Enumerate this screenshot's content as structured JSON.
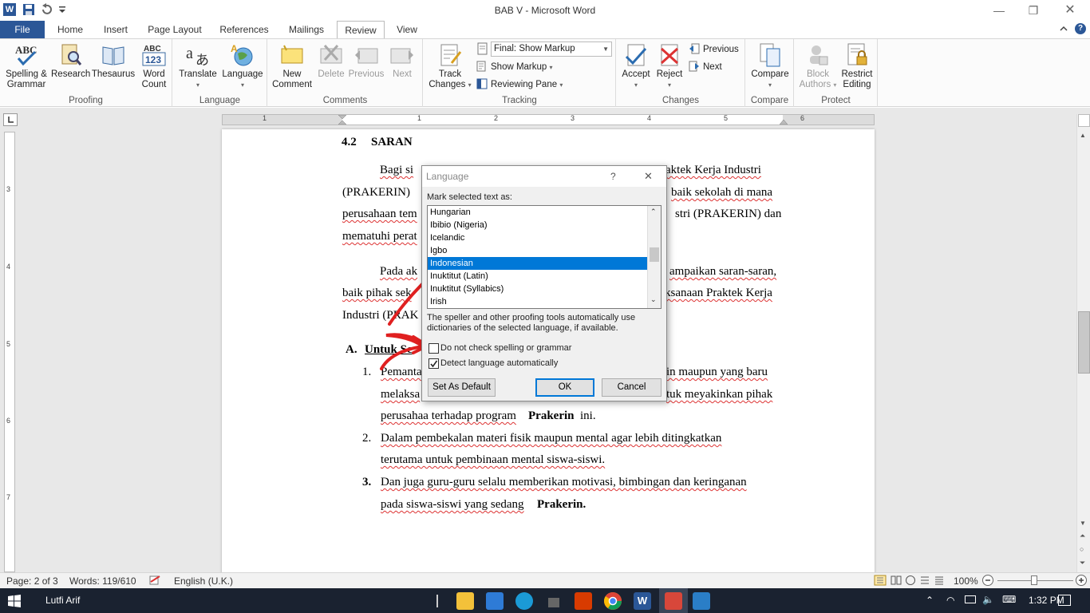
{
  "window": {
    "title": "BAB V  -  Microsoft Word"
  },
  "tabs": [
    "File",
    "Home",
    "Insert",
    "Page Layout",
    "References",
    "Mailings",
    "Review",
    "View"
  ],
  "active_tab": "Review",
  "ribbon": {
    "proofing": {
      "label": "Proofing",
      "spelling": "Spelling &",
      "spelling2": "Grammar",
      "research": "Research",
      "thesaurus": "Thesaurus",
      "wordcount": "Word",
      "wordcount2": "Count"
    },
    "language": {
      "label": "Language",
      "translate": "Translate",
      "language": "Language"
    },
    "comments": {
      "label": "Comments",
      "new": "New",
      "new2": "Comment",
      "delete": "Delete",
      "previous": "Previous",
      "next": "Next"
    },
    "tracking": {
      "label": "Tracking",
      "track": "Track",
      "track2": "Changes",
      "markup_select": "Final: Show Markup",
      "show_markup": "Show Markup",
      "reviewing_pane": "Reviewing Pane"
    },
    "changes": {
      "label": "Changes",
      "accept": "Accept",
      "reject": "Reject",
      "previous": "Previous",
      "next": "Next"
    },
    "compare": {
      "label": "Compare",
      "compare": "Compare"
    },
    "protect": {
      "label": "Protect",
      "block": "Block",
      "block2": "Authors",
      "restrict": "Restrict",
      "restrict2": "Editing"
    }
  },
  "ruler_numbers": [
    "1",
    "1",
    "2",
    "3",
    "4",
    "5",
    "6"
  ],
  "vruler_numbers": [
    "3",
    "4",
    "5",
    "6",
    "7"
  ],
  "document": {
    "heading_num": "4.2",
    "heading": "SARAN",
    "p1_l1a": "Bagi   si",
    "p1_l1b": "raktek  Kerja  Industri",
    "p1_l2a": "(PRAKERIN)",
    "p1_l2b": "baik sekolah di mana",
    "p1_l3a": "perusahaan tem",
    "p1_l3b": "stri (PRAKERIN) dan",
    "p1_l4a": "mematuhi perat",
    "p2_l1a": "Pada  ak",
    "p2_l1b": "ampaikan saran-saran,",
    "p2_l2a": "baik pihak sek",
    "p2_l2b": "ksanaan Praktek Kerja",
    "p2_l3a": "Industri (PRAK",
    "secA_letter": "A.",
    "secA_title": "Untuk Se",
    "item1_num": "1.",
    "item1_l1a": "Pemanta",
    "item1_l1b": "in maupun yang baru",
    "item1_l2a": "melaksa",
    "item1_l2b": "tuk meyakinkan pihak",
    "item1_l3": "perusahaa terhadap program",
    "item1_l3b": "Prakerin",
    "item1_l3c": "ini.",
    "item2_num": "2.",
    "item2_l1": "Dalam   pembekalan   materi   fisik   maupun   mental   agar   lebih   ditingkatkan",
    "item2_l2": "terutama untuk pembinaan mental siswa-siswi.",
    "item3_num": "3.",
    "item3_l1": "Dan  juga  guru-guru  selalu  memberikan  motivasi,  bimbingan  dan  keringanan",
    "item3_l2": "pada siswa-siswi yang sedang",
    "item3_l2b": "Prakerin."
  },
  "dialog": {
    "title": "Language",
    "help": "?",
    "close": "✕",
    "mark_label": "Mark selected text as:",
    "languages": [
      "Hungarian",
      "Ibibio (Nigeria)",
      "Icelandic",
      "Igbo",
      "Indonesian",
      "Inuktitut (Latin)",
      "Inuktitut (Syllabics)",
      "Irish"
    ],
    "selected": "Indonesian",
    "info": "The speller and other proofing tools automatically use",
    "info2": "dictionaries of the selected language, if available.",
    "no_check_label": "Do not check spelling or grammar",
    "no_check": false,
    "detect_label": "Detect language automatically",
    "detect": true,
    "set_default": "Set As Default",
    "ok": "OK",
    "cancel": "Cancel"
  },
  "status": {
    "page": "Page: 2 of 3",
    "words": "Words: 119/610",
    "language": "English (U.K.)",
    "zoom": "100%"
  },
  "taskbar": {
    "user": "Lutfi Arif",
    "time": "1:32 PM"
  },
  "colors": {
    "accent": "#2b5797",
    "selection": "#0078d7",
    "annotation": "#e02020"
  }
}
